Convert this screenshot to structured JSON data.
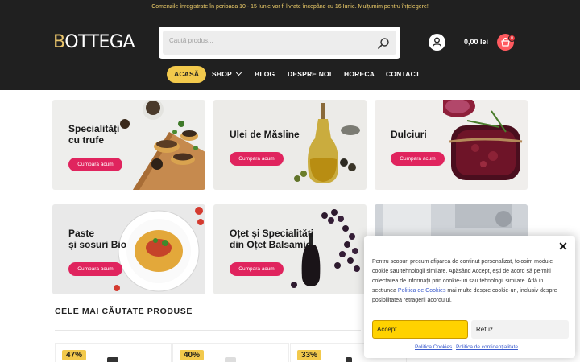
{
  "announcement": "Comenzile înregistrate în perioada 10 - 15 Iunie vor fi livrate începând cu 16 Iunie. Mulțumim pentru înțelegere!",
  "logo": {
    "first_letter": "B",
    "rest": "OTTEGA"
  },
  "search": {
    "placeholder": "Caută produs..."
  },
  "cart": {
    "total": "0,00 lei",
    "count": "0"
  },
  "nav": {
    "items": [
      {
        "label": "ACASĂ"
      },
      {
        "label": "SHOP"
      },
      {
        "label": "BLOG"
      },
      {
        "label": "DESPRE NOI"
      },
      {
        "label": "HORECA"
      },
      {
        "label": "CONTACT"
      }
    ]
  },
  "categories": [
    {
      "title_line1": "Specialități",
      "title_line2": "cu trufe",
      "button": "Cumpara acum"
    },
    {
      "title_line1": "Ulei de Măsline",
      "title_line2": "",
      "button": "Cumpara acum"
    },
    {
      "title_line1": "Dulciuri",
      "title_line2": "",
      "button": "Cumpara acum"
    },
    {
      "title_line1": "Paste",
      "title_line2": "și sosuri Bio",
      "button": "Cumpara acum"
    },
    {
      "title_line1": "Oțet și Specialități",
      "title_line2": "din Oțet Balsamic",
      "button": "Cumpara acum"
    }
  ],
  "section": {
    "title": "CELE MAI CĂUTATE PRODUSE"
  },
  "products": [
    {
      "discount": "47%"
    },
    {
      "discount": "40%"
    },
    {
      "discount": "33%"
    }
  ],
  "cookie": {
    "text_before_link": "Pentru scopuri precum afișarea de conținut personalizat, folosim module cookie sau tehnologii similare. Apăsând Accept, ești de acord să permiți colectarea de informații prin cookie-uri sau tehnologii similare. Află in sectiunea ",
    "link": "Politica de Cookies",
    "text_after_link": " mai multe despre cookie-uri, inclusiv despre posibilitatea retragerii acordului.",
    "accept": "Accept",
    "refuse": "Refuz",
    "footer_link_1": "Politica Cookies",
    "footer_link_2": "Politica de confidențialitate"
  },
  "colors": {
    "header_bg": "#202020",
    "accent_yellow": "#f2c94c",
    "button_pink": "#e0245e",
    "cart_red": "#ff5a5f"
  }
}
